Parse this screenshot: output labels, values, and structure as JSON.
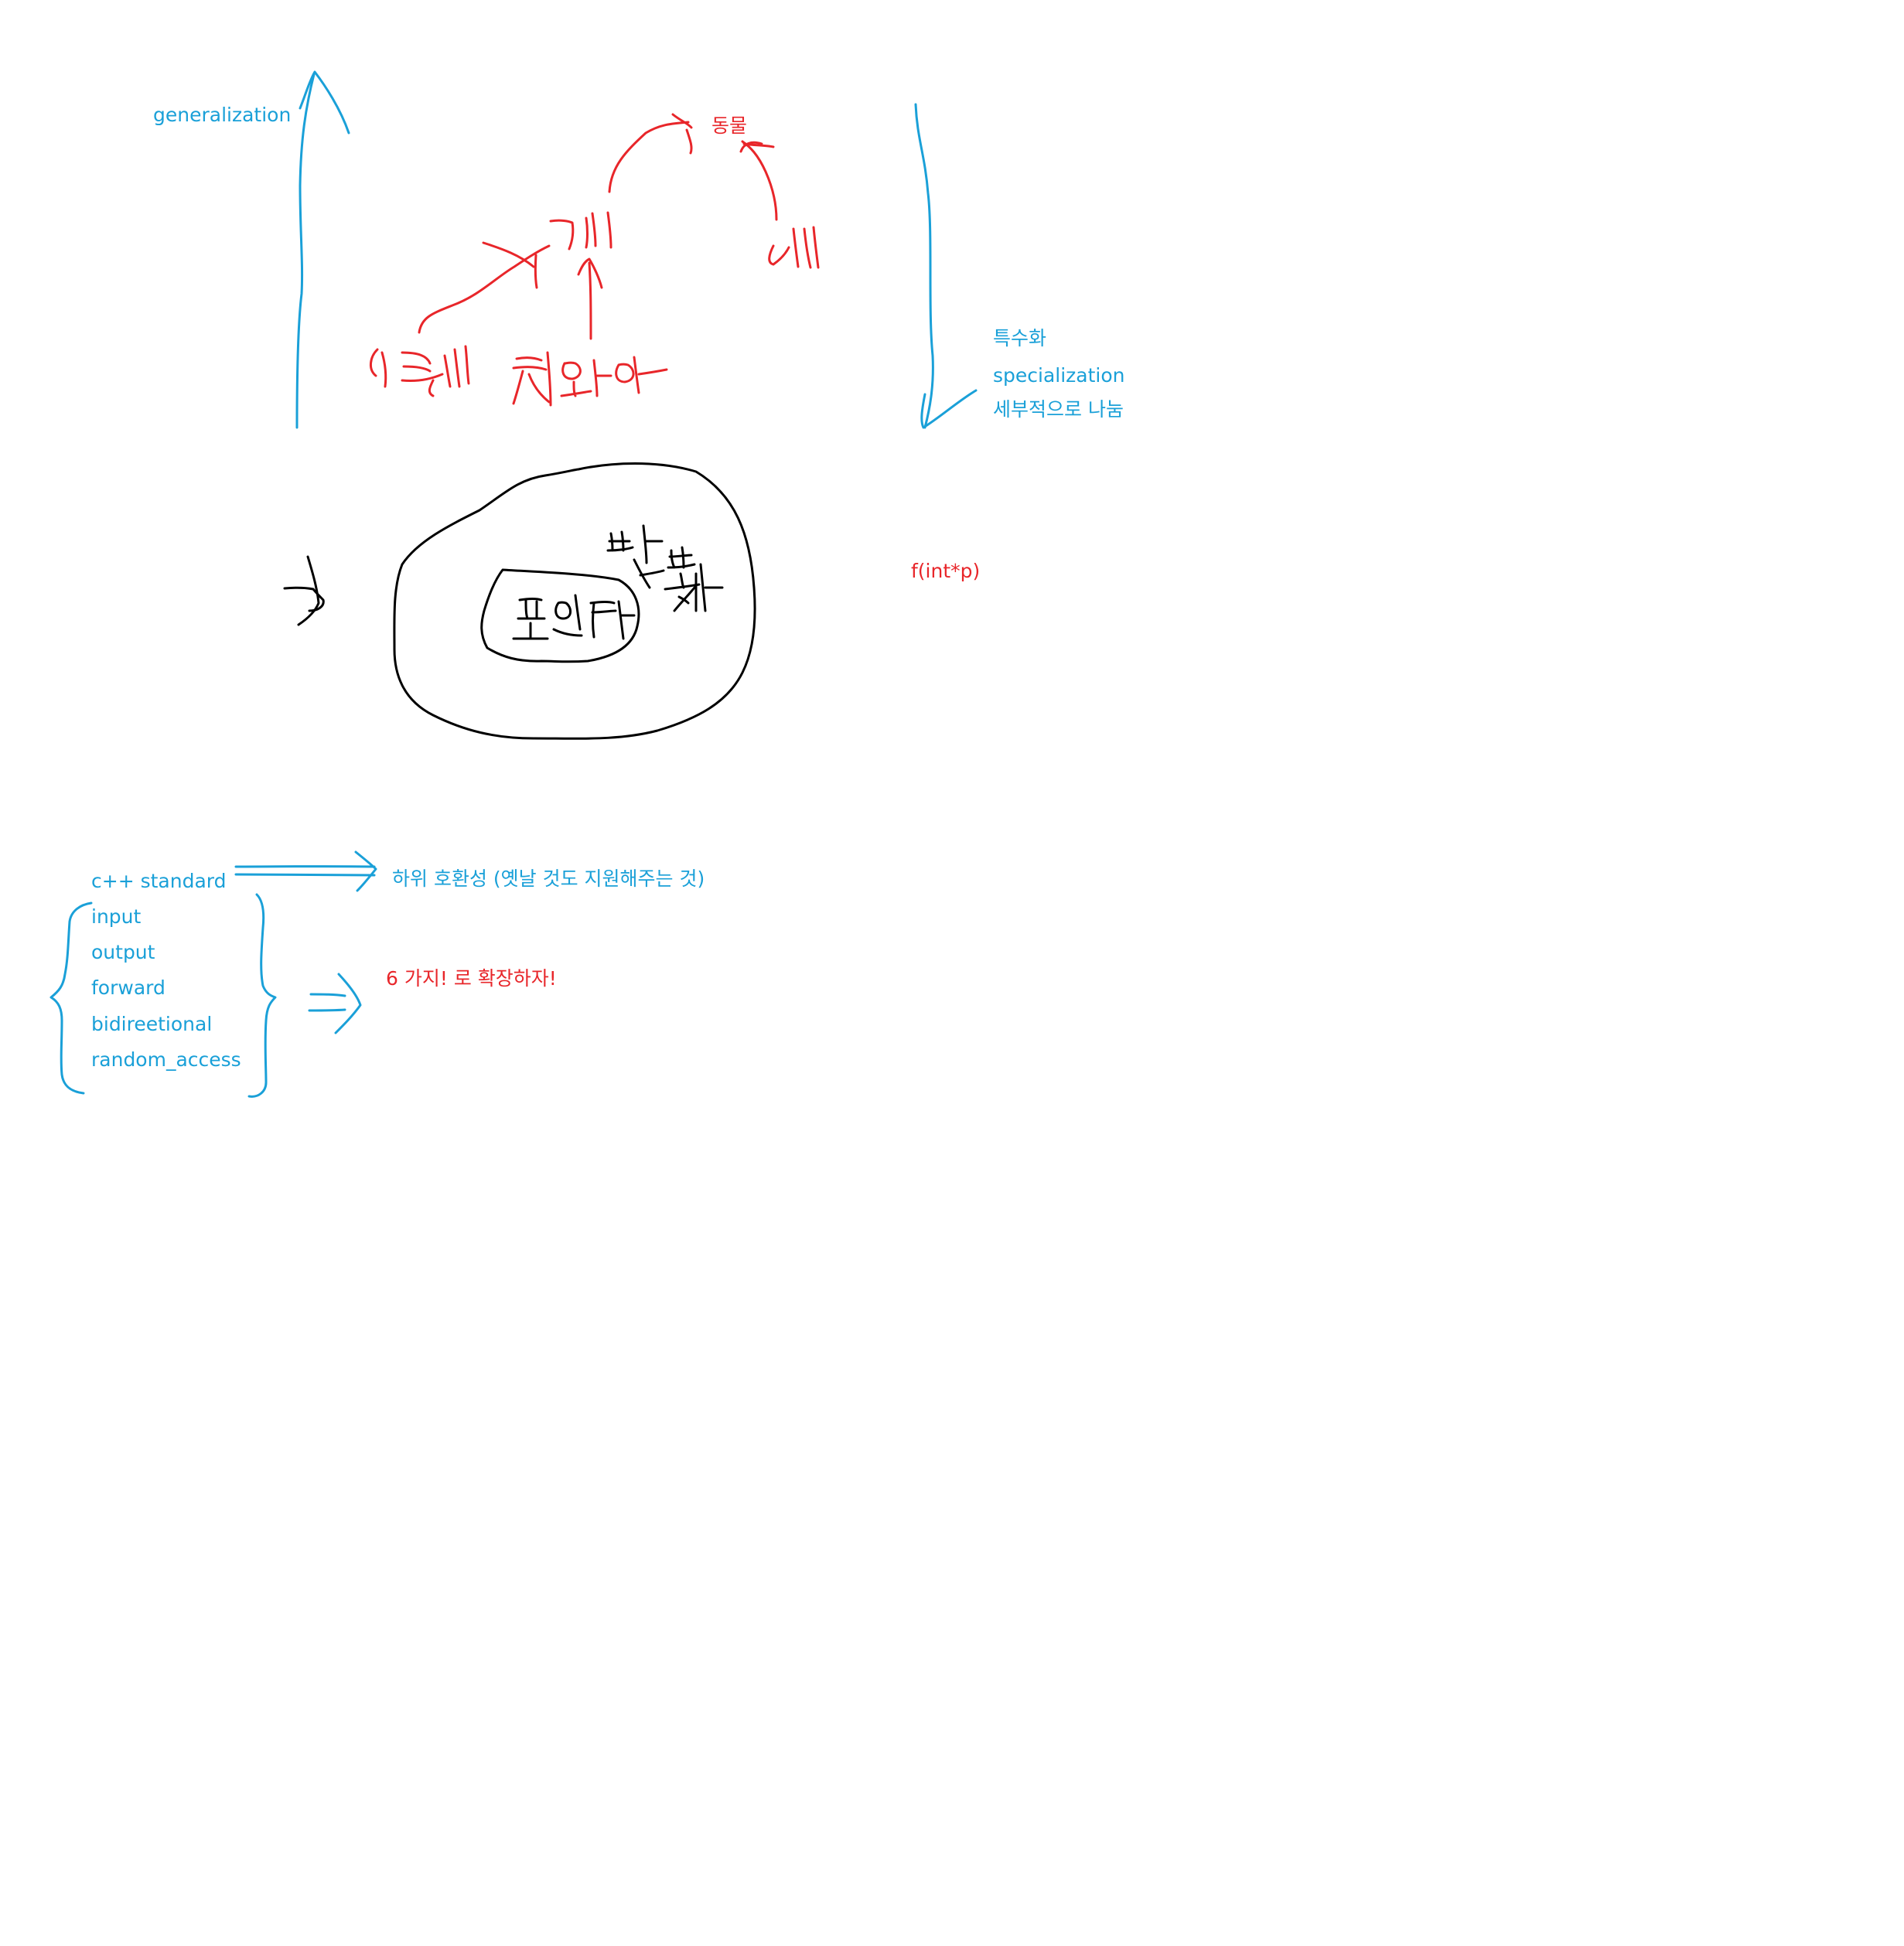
{
  "colors": {
    "blue": "#1aa0d8",
    "red": "#e8262a",
    "ink": "#000000"
  },
  "labels": {
    "generalization": "generalization",
    "animal": "동물",
    "specialization_ko": "특수화",
    "specialization": "specialization",
    "specialization_note": "세부적으로 나눔",
    "f_int_p": "f(int*p)",
    "cpp_standard": "c++ standard",
    "backward_compat": "하위 호환성  (옛날 것도 지원해주는 것)",
    "extend_six": "6 가지! 로 확장하자!"
  },
  "iterator_categories": [
    "input",
    "output",
    "forward",
    "bidireetional",
    "random_access"
  ],
  "handwriting": {
    "dog": "개",
    "bird": "새",
    "jindo": "진돗개",
    "chihuahua": "치와와",
    "iterator": "반복자",
    "pointer": "포인터"
  }
}
